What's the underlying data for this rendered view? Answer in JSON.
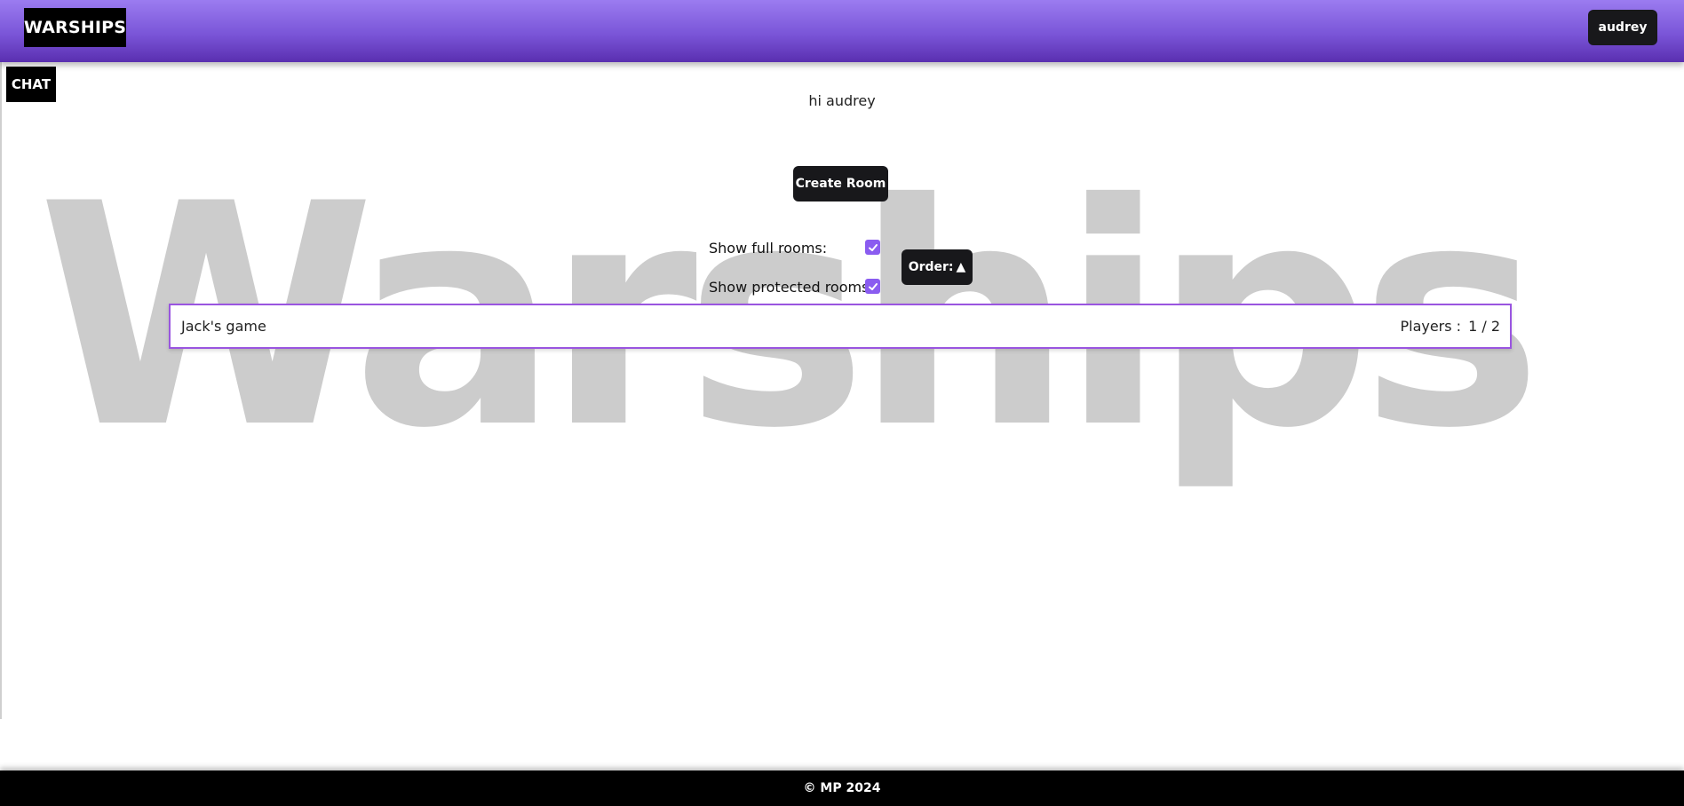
{
  "header": {
    "logo": "WARSHIPS",
    "user_name": "audrey"
  },
  "chat": {
    "label": "CHAT"
  },
  "watermark": "Warships",
  "main": {
    "greeting": "hi audrey",
    "create_room_label": "Create Room",
    "filters": {
      "full_rooms_label": "Show full rooms:",
      "full_rooms_checked": true,
      "protected_rooms_label": "Show protected rooms:",
      "protected_rooms_checked": true
    },
    "order": {
      "label": "Order:",
      "direction_icon": "▲"
    },
    "rooms": [
      {
        "name": "Jack's game",
        "players_label": "Players :",
        "players": "1 / 2"
      }
    ]
  },
  "footer": {
    "text": "© MP 2024"
  },
  "colors": {
    "header_gradient_start": "#9b7cf0",
    "header_gradient_end": "#5a2fb0",
    "accent": "#8a5cf0",
    "room_border": "#9a55e0",
    "button_bg": "#18181b"
  }
}
